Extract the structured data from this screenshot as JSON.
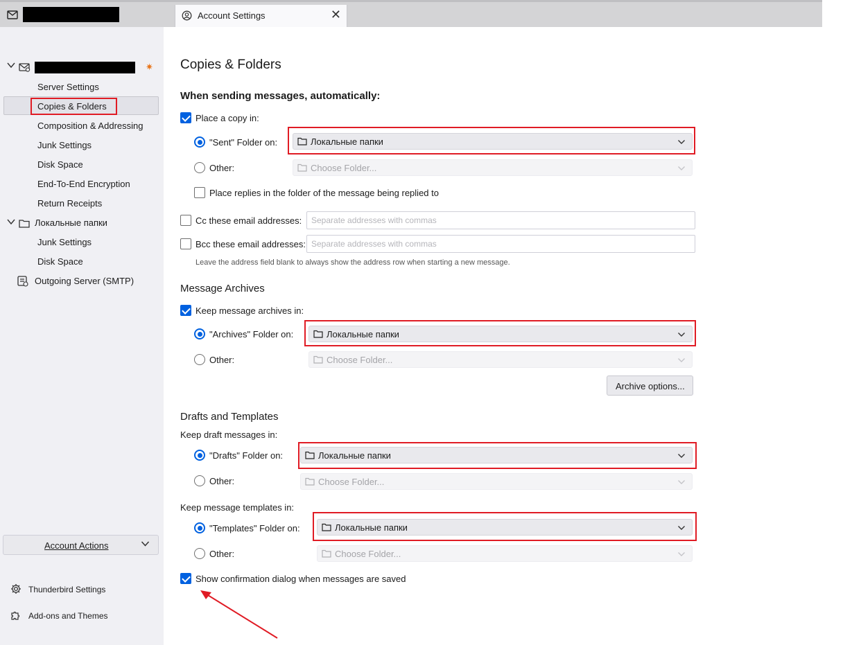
{
  "tabs": {
    "mail_tab_title": "",
    "account_settings_tab": "Account Settings"
  },
  "sidebar": {
    "account_name": "",
    "items": [
      {
        "label": "Server Settings"
      },
      {
        "label": "Copies & Folders"
      },
      {
        "label": "Composition & Addressing"
      },
      {
        "label": "Junk Settings"
      },
      {
        "label": "Disk Space"
      },
      {
        "label": "End-To-End Encryption"
      },
      {
        "label": "Return Receipts"
      }
    ],
    "local_folders": {
      "name": "Локальные папки",
      "items": [
        {
          "label": "Junk Settings"
        },
        {
          "label": "Disk Space"
        }
      ]
    },
    "outgoing_server": "Outgoing Server (SMTP)",
    "account_actions": "Account Actions",
    "thunderbird_settings": "Thunderbird Settings",
    "addons_themes": "Add-ons and Themes",
    "selected_item": "Copies & Folders"
  },
  "main": {
    "page_title": "Copies & Folders",
    "sending": {
      "heading": "When sending messages, automatically:",
      "place_copy": {
        "label": "Place a copy in:",
        "checked": true
      },
      "sent_folder_label": "\"Sent\" Folder on:",
      "sent_folder_value": "Локальные папки",
      "other_label": "Other:",
      "choose_folder": "Choose Folder...",
      "place_replies": {
        "label": "Place replies in the folder of the message being replied to",
        "checked": false
      },
      "cc_label": "Cc these email addresses:",
      "bcc_label": "Bcc these email addresses:",
      "address_placeholder": "Separate addresses with commas",
      "hint": "Leave the address field blank to always show the address row when starting a new message."
    },
    "archives": {
      "heading": "Message Archives",
      "keep_archives": {
        "label": "Keep message archives in:",
        "checked": true
      },
      "archives_folder_label": "\"Archives\" Folder on:",
      "archives_folder_value": "Локальные папки",
      "other_label": "Other:",
      "choose_folder": "Choose Folder...",
      "archive_options_button": "Archive options..."
    },
    "drafts_templates": {
      "heading": "Drafts and Templates",
      "keep_drafts": "Keep draft messages in:",
      "drafts_folder_label": "\"Drafts\" Folder on:",
      "drafts_folder_value": "Локальные папки",
      "other_label": "Other:",
      "choose_folder": "Choose Folder...",
      "keep_templates": "Keep message templates in:",
      "templates_folder_label": "\"Templates\" Folder on:",
      "templates_folder_value": "Локальные папки",
      "show_confirmation": {
        "label": "Show confirmation dialog when messages are saved",
        "checked": true
      }
    }
  },
  "colors": {
    "accent": "#0061e0",
    "highlight_red": "#e01b24",
    "sidebar_bg": "#f0f0f4"
  }
}
